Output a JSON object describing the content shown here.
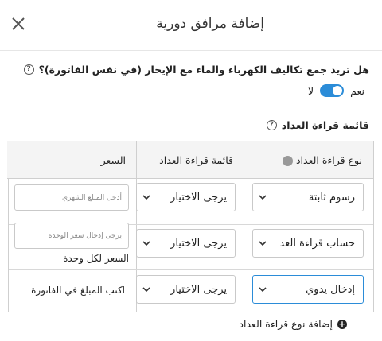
{
  "dialog": {
    "title": "إضافة مرافق دورية"
  },
  "question": {
    "text": "هل تريد جمع تكاليف الكهرباء والماء مع الإيجار (في نفس الفاتورة)؟",
    "yes_label": "نعم",
    "no_label": "لا",
    "help_glyph": "?"
  },
  "meter_list": {
    "title": "قائمة قراءة العداد",
    "help_glyph": "?"
  },
  "table": {
    "headers": [
      "نوع قراءة العداد",
      "قائمة قراءة العداد",
      "السعر"
    ],
    "rows": [
      {
        "type_value": "رسوم ثابتة",
        "list_value": "يرجى الاختيار",
        "price_placeholder": "أدخل المبلغ الشهري",
        "price_note": ""
      },
      {
        "type_value": "حساب قراءة العد",
        "list_value": "يرجى الاختيار",
        "price_placeholder": "يرجى إدخال سعر الوحدة",
        "price_note": "السعر لكل وحدة"
      },
      {
        "type_value": "إدخال يدوي",
        "list_value": "يرجى الاختيار",
        "price_placeholder": "",
        "price_note": "اكتب المبلغ في الفاتورة"
      }
    ]
  },
  "add_row": {
    "label": "إضافة نوع قراءة العداد",
    "plus": "+"
  },
  "colors": {
    "accent": "#2b8cd8",
    "header_bg": "#f4f4f4"
  }
}
